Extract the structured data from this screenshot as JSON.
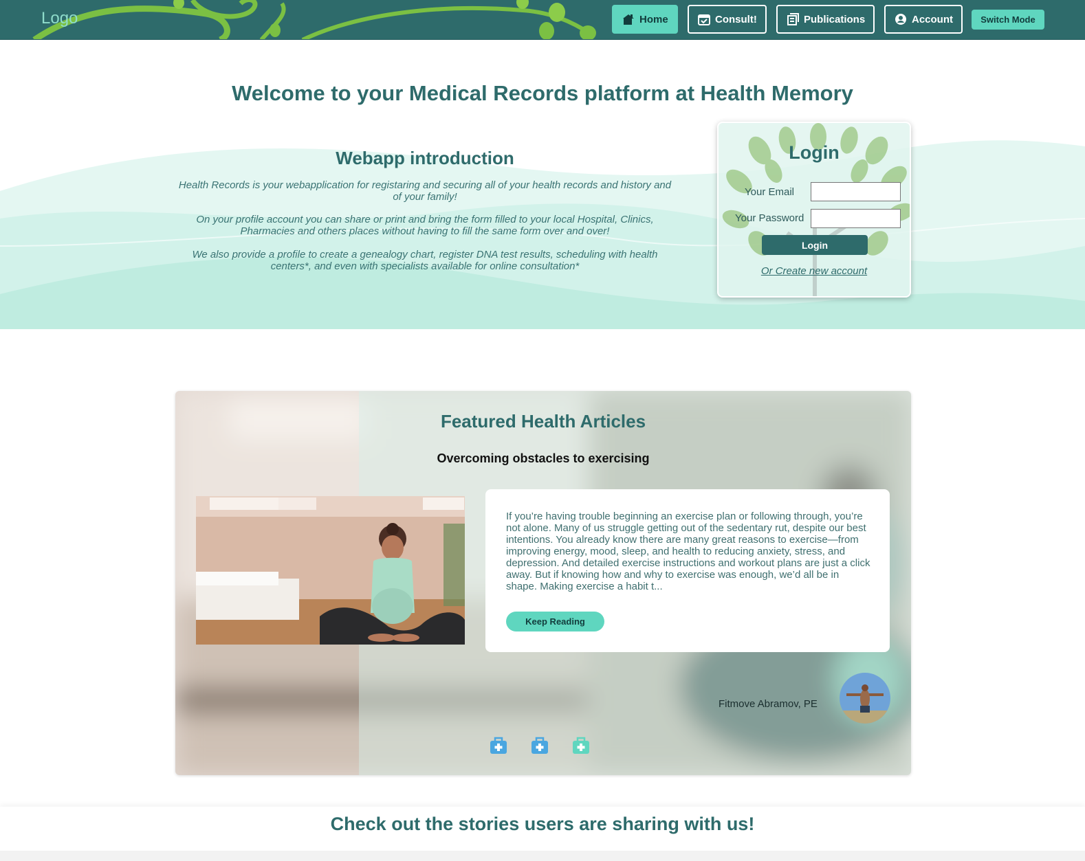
{
  "nav": {
    "logo": "Logo",
    "items": [
      {
        "label": "Home",
        "icon": "home-icon",
        "active": true
      },
      {
        "label": "Consult!",
        "icon": "calendar-check-icon",
        "active": false
      },
      {
        "label": "Publications",
        "icon": "publications-icon",
        "active": false
      },
      {
        "label": "Account",
        "icon": "account-icon",
        "active": false
      }
    ],
    "switch_mode": "Switch Mode"
  },
  "hero": {
    "title": "Welcome to your Medical Records platform at Health Memory",
    "intro_title": "Webapp introduction",
    "paragraphs": [
      "Health Records is your webapplication for registaring and securing all of your health records and history and of your family!",
      "On your profile account you can share or print and bring the form filled to your local Hospital, Clinics, Pharmacies and others places without having to fill the same form over and over!",
      "We also provide a profile to create a genealogy chart, register DNA test results, scheduling with health centers*, and even with specialists available for online consultation*"
    ]
  },
  "login": {
    "title": "Login",
    "email_label": "Your Email",
    "email_value": "",
    "password_label": "Your Password",
    "password_value": "",
    "button": "Login",
    "create_link": "Or Create new account"
  },
  "articles": {
    "title": "Featured Health Articles",
    "article_title": "Overcoming obstacles to exercising",
    "excerpt": "If you’re having trouble beginning an exercise plan or following through, you’re not alone. Many of us struggle getting out of the sedentary rut, despite our best intentions. You already know there are many great reasons to exercise—from improving energy, mood, sleep, and health to reducing anxiety, stress, and depression. And detailed exercise instructions and workout plans are just a click away. But if knowing how and why to exercise was enough, we’d all be in shape. Making exercise a habit t...",
    "keep_reading": "Keep Reading",
    "author": "Fitmove Abramov, PE",
    "carousel_dots": 3,
    "active_dot": 2
  },
  "stories": {
    "title": "Check out the stories users are sharing with us!"
  },
  "colors": {
    "primary": "#2e6b6b",
    "accent": "#5fd6bf",
    "wave_light": "#c9f0e6",
    "dot_blue": "#4aa6e0",
    "dot_active": "#5fd6bf"
  }
}
